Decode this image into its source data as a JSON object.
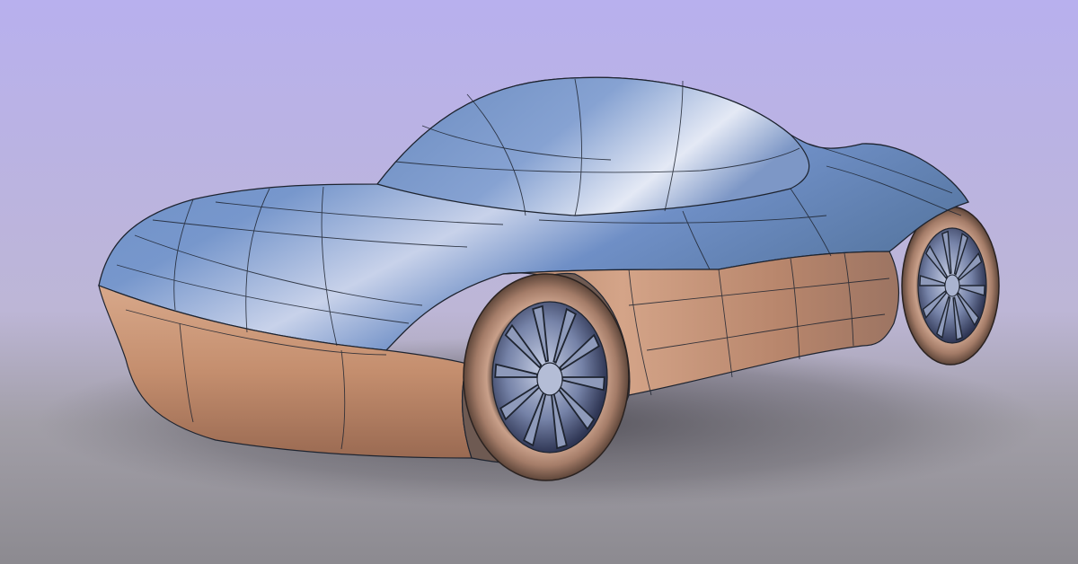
{
  "scene": {
    "subject": "car-body-model",
    "render_style": "3d-render-with-wireframe-lines",
    "colors": {
      "background_top": "#b8b0ee",
      "background_mid": "#bcb6d8",
      "floor": "#8e8c92",
      "floor_light": "#a6a3aa",
      "body_blue": "#5f86c0",
      "body_blue_dark": "#3e5f95",
      "body_highlight": "#d9e0f0",
      "body_lower_copper": "#c48e6e",
      "body_lower_copper_dark": "#8a5c45",
      "tire": "#b08a74",
      "tire_dark": "#5a4438",
      "rim": "#9aa6c6",
      "rim_dark": "#2e3552",
      "wire": "#1e2430"
    },
    "text": []
  }
}
